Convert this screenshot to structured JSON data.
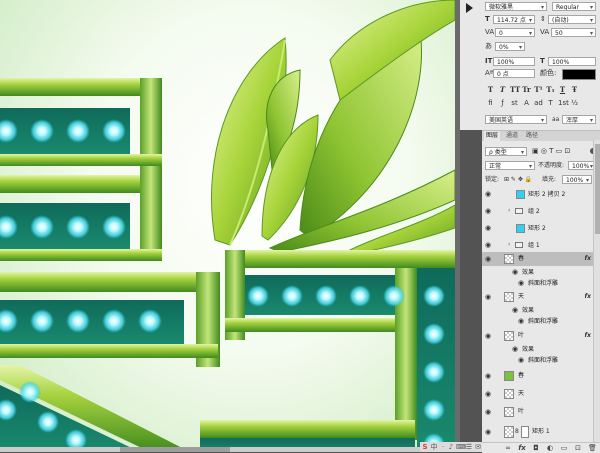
{
  "character_panel": {
    "font_family": "微软雅黑",
    "font_style": "Regular",
    "font_size": "114.72 点",
    "leading": "(自动)",
    "kerning": "0",
    "tracking": "50",
    "tsume": "0%",
    "vertical_scale": "100%",
    "horizontal_scale": "100%",
    "baseline_shift": "0 点",
    "color_label": "颜色:",
    "color_value": "#000000",
    "type_styles": [
      "T",
      "T",
      "TT",
      "Tr",
      "T¹",
      "T₁",
      "T",
      "Ŧ"
    ],
    "ligature_glyphs": [
      "fi",
      "ƒ",
      "st",
      "A",
      "ad",
      "T",
      "1st",
      "½"
    ],
    "language": "美国英语",
    "anti_alias_icon": "aa",
    "anti_alias": "浑厚"
  },
  "layers_panel": {
    "tabs": [
      "图层",
      "通道",
      "路径"
    ],
    "filter_kind": "ρ 类型",
    "blend_mode": "正常",
    "opacity_label": "不透明度:",
    "opacity_value": "100%",
    "lock_label": "锁定:",
    "fill_label": "填充:",
    "fill_value": "100%",
    "fx_label": "fx",
    "rows": [
      {
        "name": "矩形 2 拷贝 2",
        "thumb": "cyan"
      },
      {
        "name": "组 2",
        "thumb": "folder"
      },
      {
        "name": "矩形 2",
        "thumb": "cyan"
      },
      {
        "name": "组 1",
        "thumb": "folder"
      },
      {
        "name": "春",
        "thumb": "checker"
      },
      {
        "name": "效果",
        "thumb": "effect"
      },
      {
        "name": "斜面和浮雕",
        "thumb": "effect"
      },
      {
        "name": "天",
        "thumb": "checker"
      },
      {
        "name": "效果",
        "thumb": "effect"
      },
      {
        "name": "斜面和浮雕",
        "thumb": "effect"
      },
      {
        "name": "叶",
        "thumb": "checker"
      },
      {
        "name": "效果",
        "thumb": "effect"
      },
      {
        "name": "斜面和浮雕",
        "thumb": "effect"
      },
      {
        "name": "春",
        "thumb": "green"
      },
      {
        "name": "天",
        "thumb": "checker"
      },
      {
        "name": "叶",
        "thumb": "checker"
      },
      {
        "name": "矩形 1",
        "thumb": "white"
      }
    ]
  },
  "colors": {
    "glow_bulb": "#a8f6ff",
    "bar_green": "#8fc63a",
    "leaf_green": "#9ccc34"
  },
  "taskbar": {
    "icons": [
      "S",
      "中",
      "·",
      "♪",
      "⌨",
      "☰",
      "✉"
    ]
  }
}
